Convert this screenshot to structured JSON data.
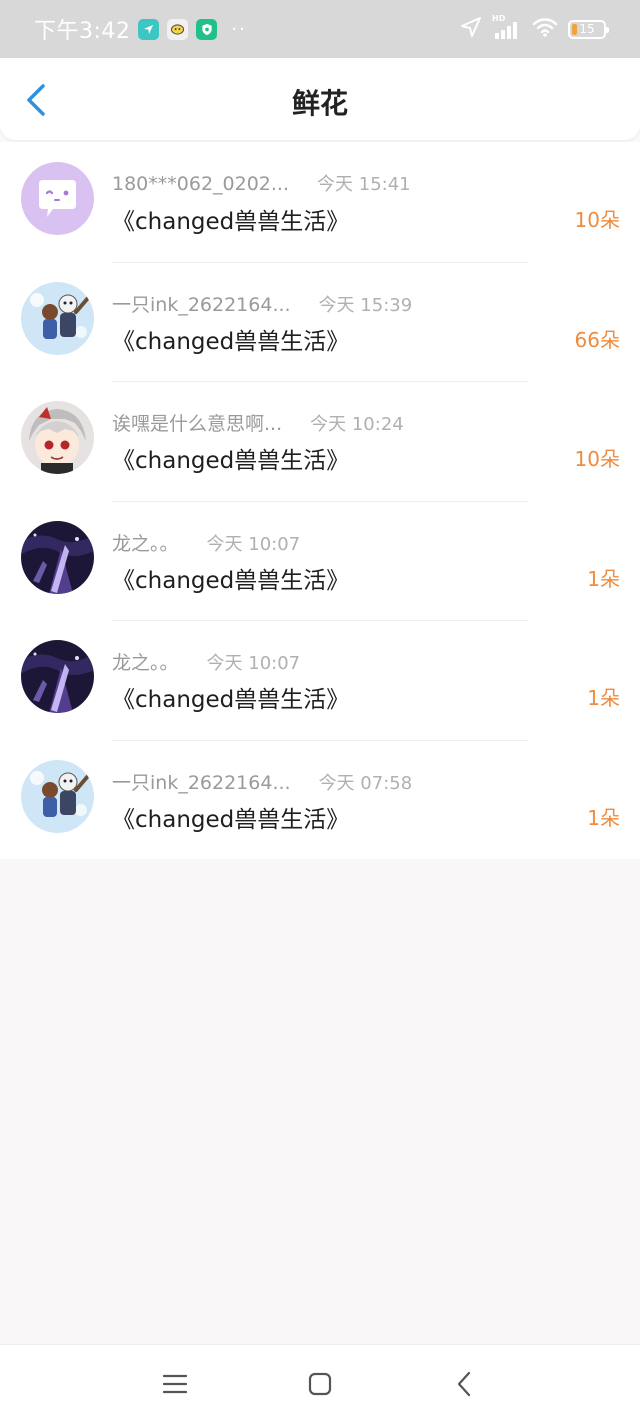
{
  "status_bar": {
    "time": "下午3:42",
    "app_icons": [
      "navigation-app-icon",
      "chat-app-icon",
      "security-app-icon"
    ],
    "more": "··",
    "battery": "15",
    "battery_fraction": 0.15,
    "signal_badge": "HD"
  },
  "header": {
    "title": "鲜花"
  },
  "list": [
    {
      "name": "180***062_0202...",
      "time": "今天 15:41",
      "book": "《changed兽兽生活》",
      "count": "10朵"
    },
    {
      "name": "一只ink_2622164...",
      "time": "今天 15:39",
      "book": "《changed兽兽生活》",
      "count": "66朵"
    },
    {
      "name": "诶嘿是什么意思啊...",
      "time": "今天 10:24",
      "book": "《changed兽兽生活》",
      "count": "10朵"
    },
    {
      "name": "龙之。。",
      "time": "今天 10:07",
      "book": "《changed兽兽生活》",
      "count": "1朵"
    },
    {
      "name": "龙之。。",
      "time": "今天 10:07",
      "book": "《changed兽兽生活》",
      "count": "1朵"
    },
    {
      "name": "一只ink_2622164...",
      "time": "今天 07:58",
      "book": "《changed兽兽生活》",
      "count": "1朵"
    }
  ],
  "colors": {
    "accent": "#2f8fe0",
    "count": "#f08a3c",
    "status_bar": "#d8d8d8"
  }
}
